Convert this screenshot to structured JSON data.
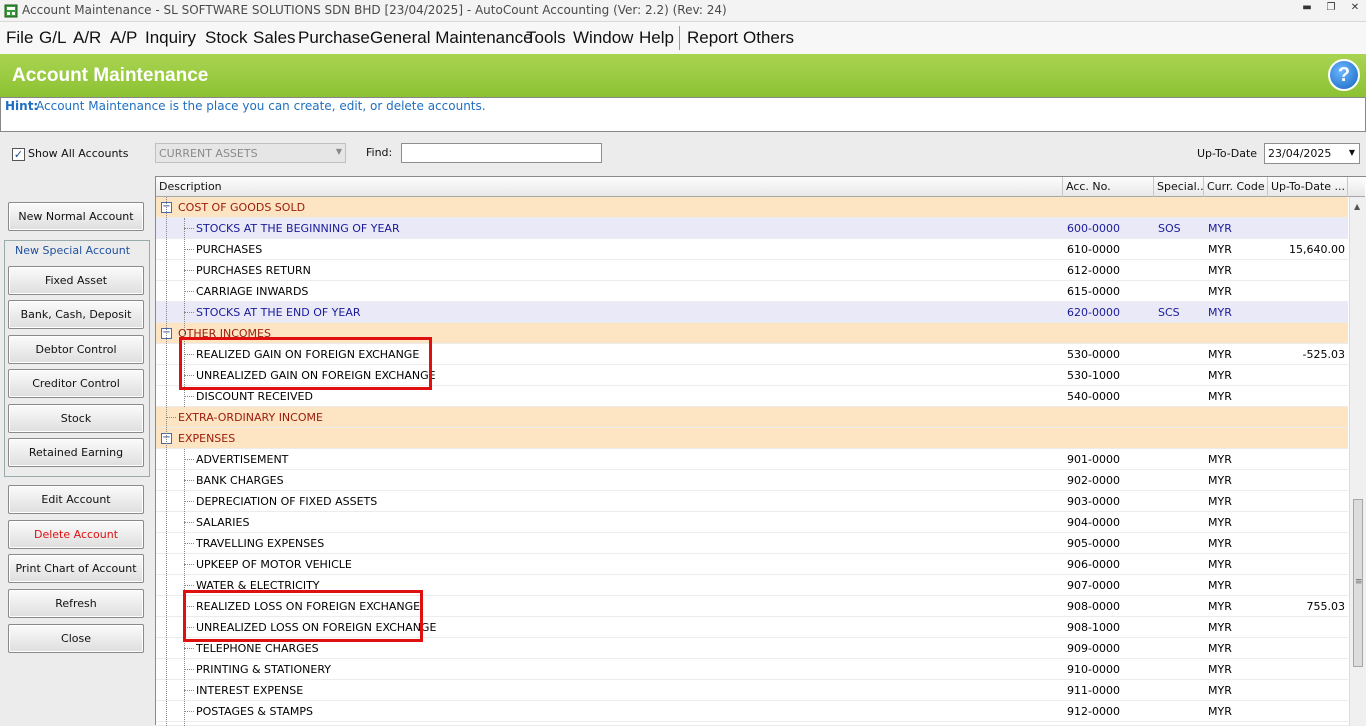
{
  "window": {
    "title": "Account Maintenance - SL SOFTWARE SOLUTIONS SDN BHD [23/04/2025] - AutoCount Accounting (Ver: 2.2) (Rev: 24)"
  },
  "menu": {
    "items": [
      "File",
      "G/L",
      "A/R",
      "A/P",
      "Inquiry",
      "Stock",
      "Sales",
      "Purchase",
      "General Maintenance",
      "Tools",
      "Window",
      "Help",
      "Report",
      "Others"
    ]
  },
  "header": {
    "title": "Account Maintenance",
    "help_icon": "?"
  },
  "hint": {
    "label": "Hint:",
    "text": "Account Maintenance is the place you can create, edit, or delete accounts."
  },
  "toolbar": {
    "show_all_label": "Show All Accounts",
    "show_all_checked": true,
    "category_value": "CURRENT ASSETS",
    "find_label": "Find:",
    "find_value": "",
    "up_to_date_label": "Up-To-Date",
    "up_to_date_value": "23/04/2025"
  },
  "sidebar": {
    "new_normal": "New Normal Account",
    "special_group_label": "New Special Account",
    "special_buttons": [
      "Fixed Asset",
      "Bank, Cash, Deposit",
      "Debtor Control",
      "Creditor Control",
      "Stock",
      "Retained Earning"
    ],
    "edit": "Edit Account",
    "delete": "Delete Account",
    "print": "Print Chart of Account",
    "refresh": "Refresh",
    "close": "Close"
  },
  "grid": {
    "columns": [
      "Description",
      "Acc. No.",
      "Special...",
      "Curr. Code",
      "Up-To-Date ..."
    ],
    "rows": [
      {
        "type": "group",
        "desc": "COST OF GOODS SOLD",
        "expander": "−",
        "acc": "",
        "special": "",
        "curr": "",
        "amt": ""
      },
      {
        "type": "special",
        "desc": "STOCKS AT THE BEGINNING OF YEAR",
        "acc": "600-0000",
        "special": "SOS",
        "curr": "MYR",
        "amt": ""
      },
      {
        "type": "normal",
        "desc": "PURCHASES",
        "acc": "610-0000",
        "special": "",
        "curr": "MYR",
        "amt": "15,640.00"
      },
      {
        "type": "normal",
        "desc": "PURCHASES RETURN",
        "acc": "612-0000",
        "special": "",
        "curr": "MYR",
        "amt": ""
      },
      {
        "type": "normal",
        "desc": "CARRIAGE INWARDS",
        "acc": "615-0000",
        "special": "",
        "curr": "MYR",
        "amt": ""
      },
      {
        "type": "special",
        "desc": "STOCKS AT THE END OF YEAR",
        "acc": "620-0000",
        "special": "SCS",
        "curr": "MYR",
        "amt": ""
      },
      {
        "type": "group",
        "desc": "OTHER INCOMES",
        "expander": "−",
        "acc": "",
        "special": "",
        "curr": "",
        "amt": ""
      },
      {
        "type": "normal",
        "desc": "REALIZED GAIN ON FOREIGN EXCHANGE",
        "acc": "530-0000",
        "special": "",
        "curr": "MYR",
        "amt": "-525.03"
      },
      {
        "type": "normal",
        "desc": "UNREALIZED GAIN ON FOREIGN EXCHANGE",
        "acc": "530-1000",
        "special": "",
        "curr": "MYR",
        "amt": ""
      },
      {
        "type": "normal",
        "desc": "DISCOUNT RECEIVED",
        "acc": "540-0000",
        "special": "",
        "curr": "MYR",
        "amt": ""
      },
      {
        "type": "group",
        "desc": "EXTRA-ORDINARY INCOME",
        "expander": "",
        "acc": "",
        "special": "",
        "curr": "",
        "amt": ""
      },
      {
        "type": "group",
        "desc": "EXPENSES",
        "expander": "−",
        "acc": "",
        "special": "",
        "curr": "",
        "amt": ""
      },
      {
        "type": "normal",
        "desc": "ADVERTISEMENT",
        "acc": "901-0000",
        "special": "",
        "curr": "MYR",
        "amt": ""
      },
      {
        "type": "normal",
        "desc": "BANK CHARGES",
        "acc": "902-0000",
        "special": "",
        "curr": "MYR",
        "amt": ""
      },
      {
        "type": "normal",
        "desc": "DEPRECIATION OF FIXED ASSETS",
        "acc": "903-0000",
        "special": "",
        "curr": "MYR",
        "amt": ""
      },
      {
        "type": "normal",
        "desc": "SALARIES",
        "acc": "904-0000",
        "special": "",
        "curr": "MYR",
        "amt": ""
      },
      {
        "type": "normal",
        "desc": "TRAVELLING EXPENSES",
        "acc": "905-0000",
        "special": "",
        "curr": "MYR",
        "amt": ""
      },
      {
        "type": "normal",
        "desc": "UPKEEP OF MOTOR VEHICLE",
        "acc": "906-0000",
        "special": "",
        "curr": "MYR",
        "amt": ""
      },
      {
        "type": "normal",
        "desc": "WATER & ELECTRICITY",
        "acc": "907-0000",
        "special": "",
        "curr": "MYR",
        "amt": ""
      },
      {
        "type": "normal",
        "desc": "REALIZED LOSS ON FOREIGN EXCHANGE",
        "acc": "908-0000",
        "special": "",
        "curr": "MYR",
        "amt": "755.03"
      },
      {
        "type": "normal",
        "desc": "UNREALIZED LOSS ON FOREIGN EXCHANGE",
        "acc": "908-1000",
        "special": "",
        "curr": "MYR",
        "amt": ""
      },
      {
        "type": "normal",
        "desc": "TELEPHONE CHARGES",
        "acc": "909-0000",
        "special": "",
        "curr": "MYR",
        "amt": ""
      },
      {
        "type": "normal",
        "desc": "PRINTING & STATIONERY",
        "acc": "910-0000",
        "special": "",
        "curr": "MYR",
        "amt": ""
      },
      {
        "type": "normal",
        "desc": "INTEREST EXPENSE",
        "acc": "911-0000",
        "special": "",
        "curr": "MYR",
        "amt": ""
      },
      {
        "type": "normal",
        "desc": "POSTAGES & STAMPS",
        "acc": "912-0000",
        "special": "",
        "curr": "MYR",
        "amt": ""
      }
    ]
  },
  "annotations": {
    "highlight_color": "#e01010"
  }
}
